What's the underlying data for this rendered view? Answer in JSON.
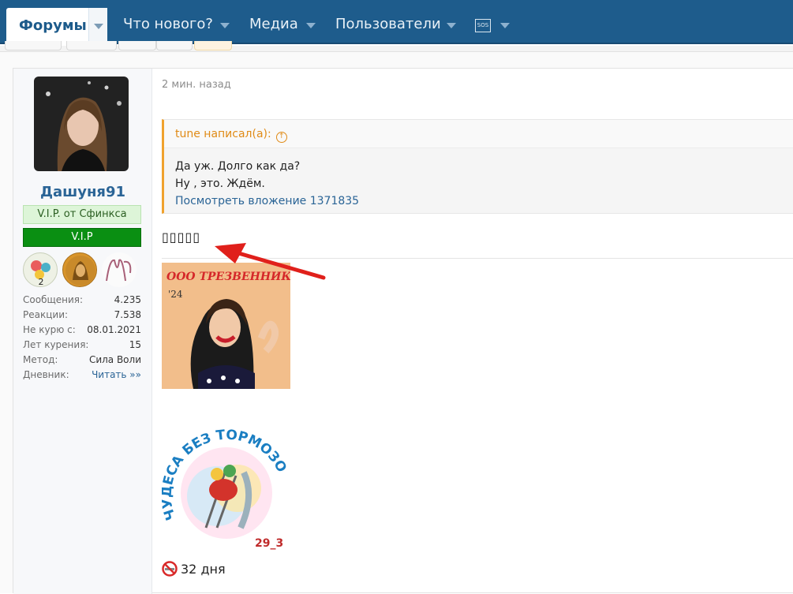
{
  "nav": {
    "active_label": "Форумы",
    "items": [
      {
        "label": "Что нового?"
      },
      {
        "label": "Медиа"
      },
      {
        "label": "Пользователи"
      }
    ],
    "sos_label": "SOS"
  },
  "user": {
    "name": "Дашуня91",
    "badge_vip_from": "V.I.P. от Сфинкса",
    "badge_vip": "V.I.P",
    "stats": [
      {
        "k": "Сообщения:",
        "v": "4.235"
      },
      {
        "k": "Реакции:",
        "v": "7.538"
      },
      {
        "k": "Не курю с:",
        "v": "08.01.2021"
      },
      {
        "k": "Лет курения:",
        "v": "15"
      },
      {
        "k": "Метод:",
        "v": "Сила Воли"
      },
      {
        "k": "Дневник:",
        "v": "Читать »»"
      }
    ]
  },
  "post": {
    "timestamp": "2 мин. назад",
    "quote_author": "tune написал(а):",
    "quote_lines": [
      "Да уж. Долго как да?",
      "Ну , это. Ждём."
    ],
    "quote_link": "Посмотреть вложение 1371835",
    "boxes": "▯▯▯▯▯",
    "image1_text_top": "ООО ТРЕЗВЕННИК",
    "image1_text_year": "'24",
    "image2_text_arc": "ЧУДЕСА БЕЗ ТОРМОЗОВ",
    "image2_text_num": "29_3",
    "footer_days": "32 дня"
  },
  "colors": {
    "nav_bg": "#1e5c8c",
    "link": "#2a6496",
    "quote_accent": "#e08b17",
    "vip_green": "#0a8f12",
    "arrow_red": "#e0201b"
  }
}
